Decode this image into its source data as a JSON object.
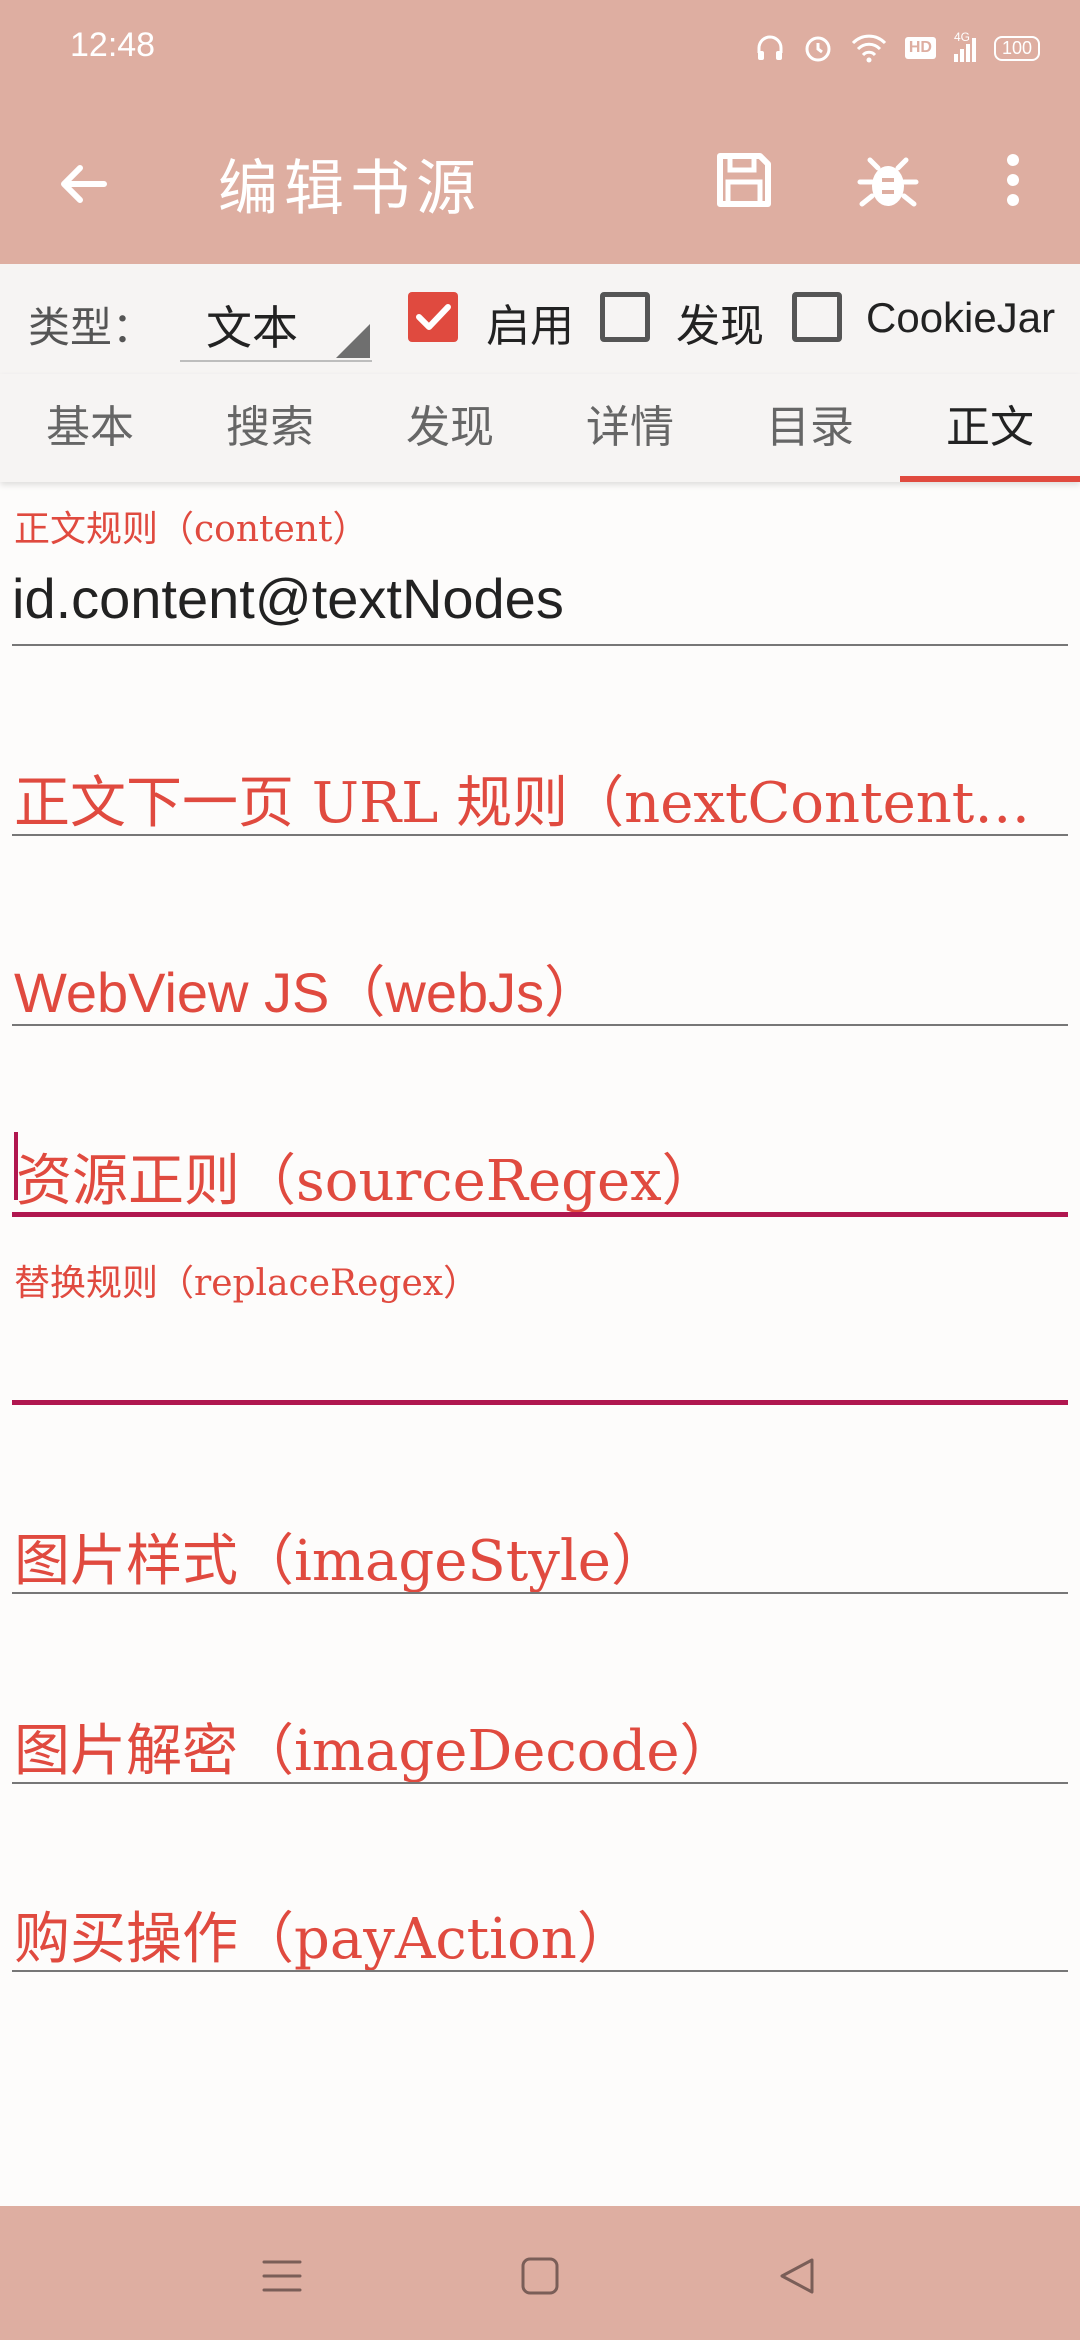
{
  "status_bar": {
    "time": "12:48",
    "battery": "100",
    "network": "4G",
    "hd_badge": "HD",
    "icons": [
      "headphones-icon",
      "alarm-icon",
      "wifi-icon",
      "hd-icon",
      "signal-icon",
      "battery-icon"
    ]
  },
  "toolbar": {
    "title": "编辑书源",
    "back_icon": "arrow-back-icon",
    "save_icon": "save-icon",
    "debug_icon": "bug-icon",
    "more_icon": "more-vert-icon"
  },
  "type_bar": {
    "label": "类型：",
    "selected_type": "文本",
    "checkboxes": [
      {
        "label": "启用",
        "checked": true
      },
      {
        "label": "发现",
        "checked": false
      },
      {
        "label": "CookieJar",
        "checked": false
      }
    ]
  },
  "tabs": [
    {
      "label": "基本",
      "active": false
    },
    {
      "label": "搜索",
      "active": false
    },
    {
      "label": "发现",
      "active": false
    },
    {
      "label": "详情",
      "active": false
    },
    {
      "label": "目录",
      "active": false
    },
    {
      "label": "正文",
      "active": true
    }
  ],
  "fields": {
    "content": {
      "label": "正文规则（content）",
      "value": "id.content@textNodes"
    },
    "next_content_url": {
      "hint": "正文下一页 URL 规则（nextContent…"
    },
    "web_js": {
      "hint": "WebView JS（webJs）"
    },
    "source_regex": {
      "hint": "资源正则（sourceRegex）",
      "focused": true
    },
    "replace_regex": {
      "label": "替换规则（replaceRegex）",
      "value": ""
    },
    "image_style": {
      "hint": "图片样式（imageStyle）"
    },
    "image_decode": {
      "hint": "图片解密（imageDecode）"
    },
    "pay_action": {
      "hint": "购买操作（payAction）"
    }
  },
  "nav_bar": {
    "icons": [
      "menu-icon",
      "home-icon",
      "back-triangle-icon"
    ]
  },
  "colors": {
    "app_bar": "#deaea1",
    "accent": "#e04a3f",
    "focus_line": "#b0174f",
    "background": "#fdfcfb"
  }
}
